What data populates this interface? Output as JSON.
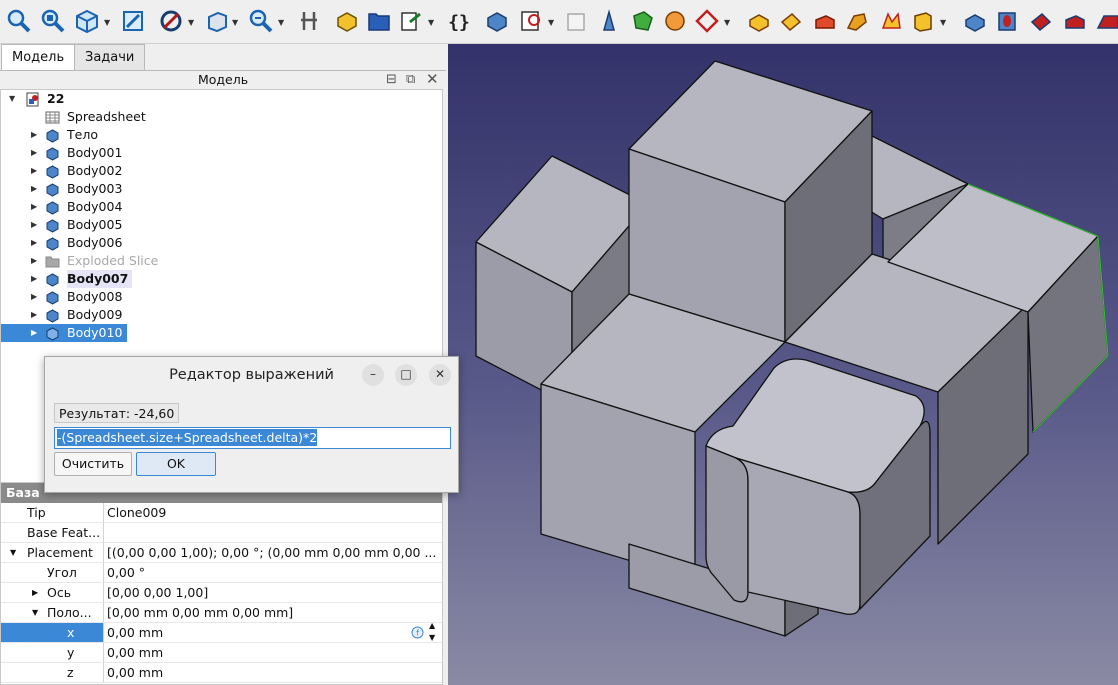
{
  "tabs": [
    {
      "label": "Модель"
    },
    {
      "label": "Задачи"
    }
  ],
  "model_panel": {
    "title": "Модель"
  },
  "tree": {
    "root": "22",
    "items": [
      {
        "label": "Spreadsheet"
      },
      {
        "label": "Тело"
      },
      {
        "label": "Body001"
      },
      {
        "label": "Body002"
      },
      {
        "label": "Body003"
      },
      {
        "label": "Body004"
      },
      {
        "label": "Body005"
      },
      {
        "label": "Body006"
      },
      {
        "label": "Exploded Slice"
      },
      {
        "label": "Body007"
      },
      {
        "label": "Body008"
      },
      {
        "label": "Body009"
      },
      {
        "label": "Body010"
      }
    ]
  },
  "properties": {
    "group": "База",
    "rows": [
      {
        "name": "Tip",
        "value": "Clone009"
      },
      {
        "name": "Base Feat...",
        "value": ""
      },
      {
        "name": "Placement",
        "value": "[(0,00 0,00 1,00); 0,00 °; (0,00 mm  0,00 mm  0,00 ..."
      },
      {
        "name": "Угол",
        "value": "0,00 °"
      },
      {
        "name": "Ось",
        "value": "[0,00 0,00 1,00]"
      },
      {
        "name": "Поло...",
        "value": "[0,00 mm  0,00 mm  0,00 mm]"
      },
      {
        "name": "x",
        "value": "0,00 mm"
      },
      {
        "name": "y",
        "value": "0,00 mm"
      },
      {
        "name": "z",
        "value": "0,00 mm"
      }
    ]
  },
  "dialog": {
    "title": "Редактор выражений",
    "result": "Результат: -24,60",
    "expression": "-(Spreadsheet.size+Spreadsheet.delta)*2",
    "clear_label": "Очистить",
    "ok_label": "OK"
  },
  "colors": {
    "selection": "#3a88d6",
    "viewport_top": "#33326a",
    "viewport_bottom": "#8a8aa4"
  }
}
